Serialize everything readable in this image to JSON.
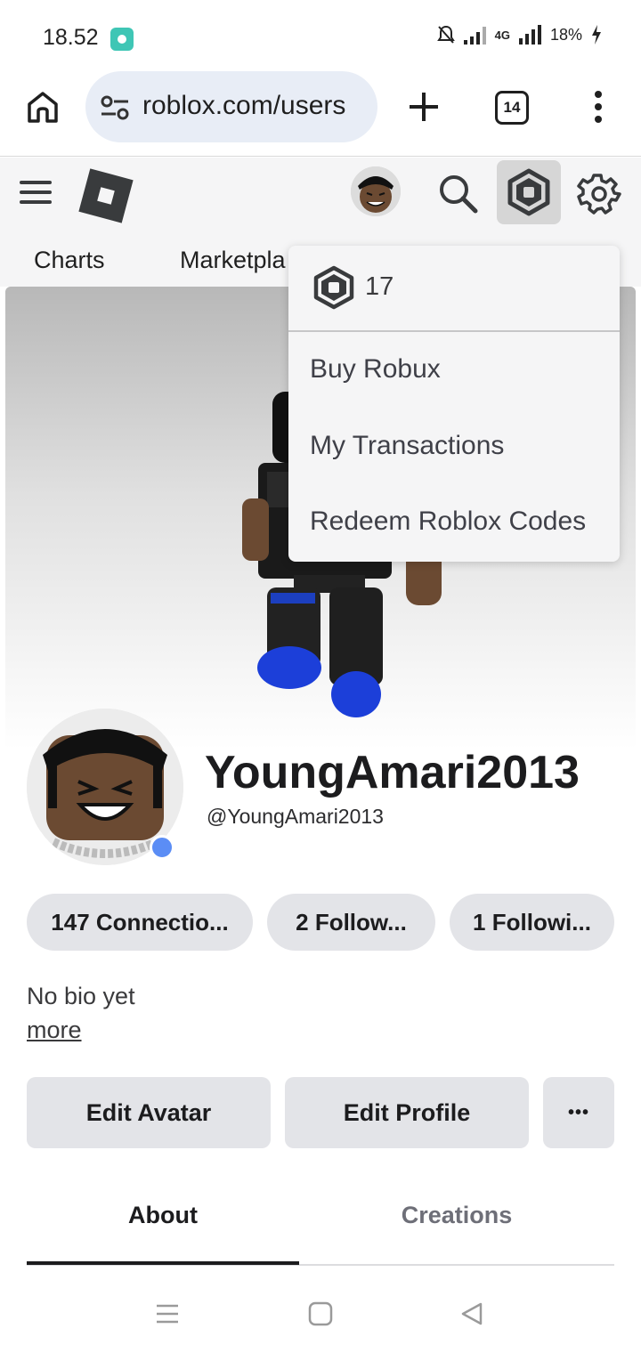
{
  "status_bar": {
    "time": "18.52",
    "network": "4G",
    "battery": "18%"
  },
  "browser": {
    "url": "roblox.com/users",
    "tab_count": "14"
  },
  "nav": {
    "charts": "Charts",
    "marketplace": "Marketpla"
  },
  "robux_menu": {
    "balance": "17",
    "items": [
      "Buy Robux",
      "My Transactions",
      "Redeem Roblox Codes"
    ]
  },
  "profile": {
    "display_name": "YoungAmari2013",
    "username": "@YoungAmari2013",
    "connections": "147 Connectio...",
    "followers": "2 Follow...",
    "following": "1 Followi...",
    "bio": "No bio yet",
    "more": "more"
  },
  "actions": {
    "edit_avatar": "Edit Avatar",
    "edit_profile": "Edit Profile",
    "more_options": "•••"
  },
  "tabs": {
    "about": "About",
    "creations": "Creations"
  },
  "colors": {
    "accent": "#5b8df5",
    "pill_bg": "#e3e4e8",
    "header_bg": "#f5f5f6"
  }
}
